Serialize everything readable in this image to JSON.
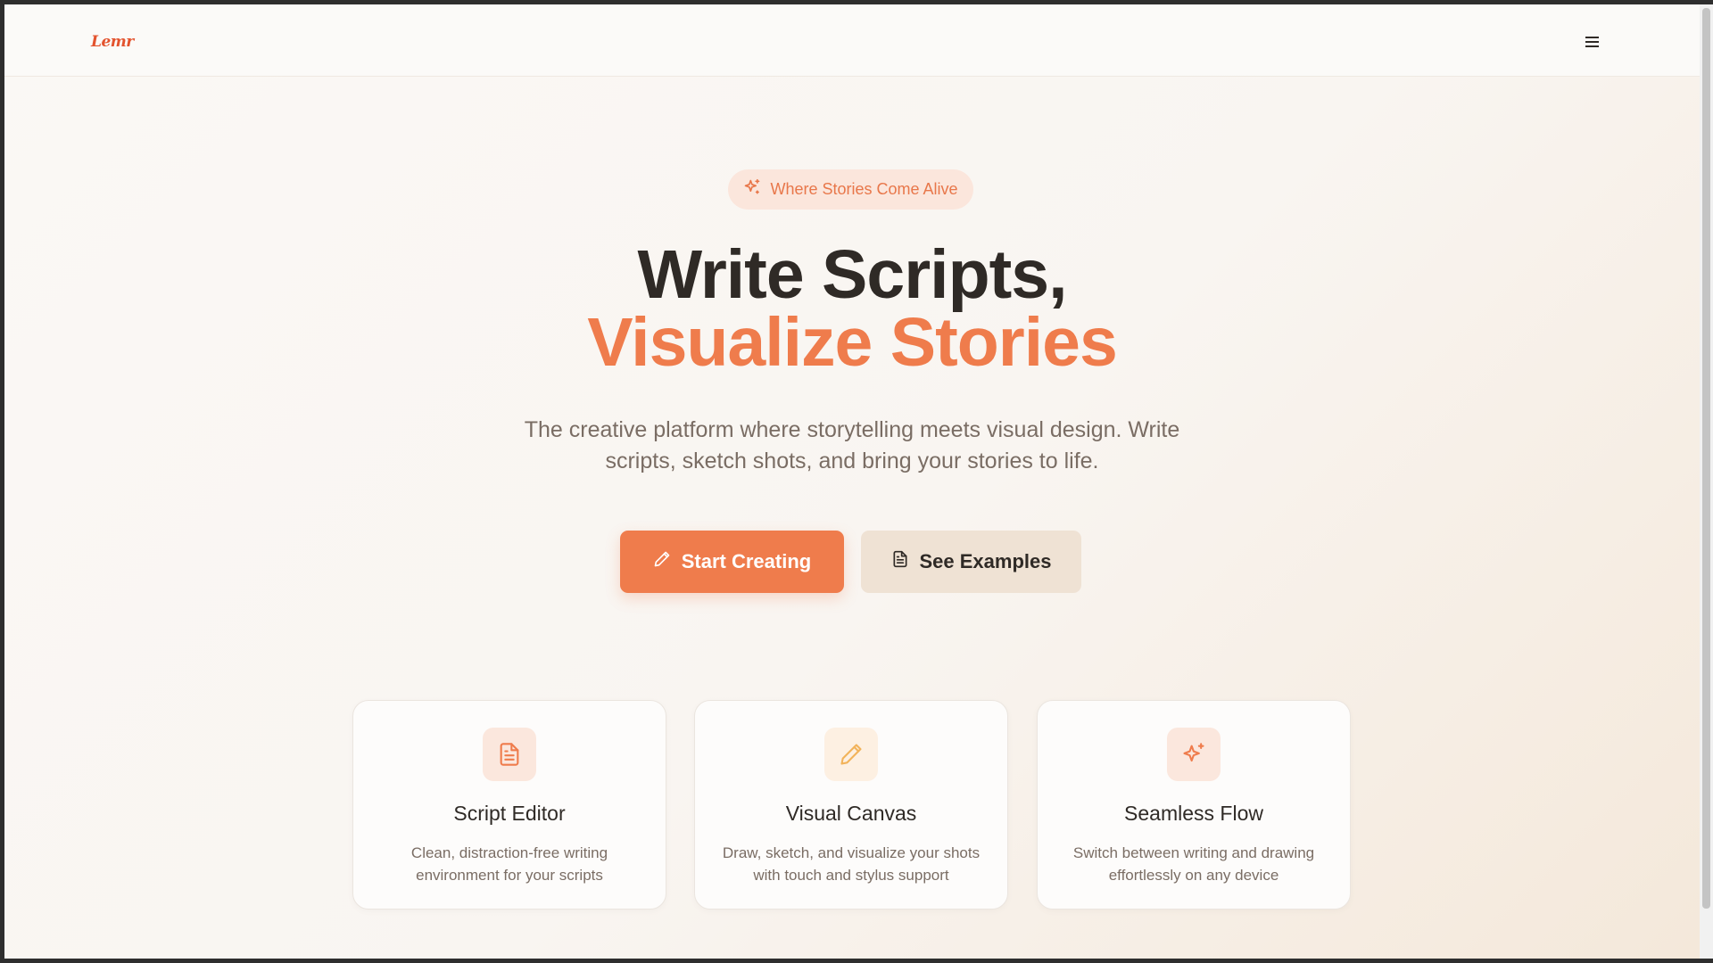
{
  "nav": {
    "logo": "Lemr",
    "menu_icon": "hamburger-icon"
  },
  "hero": {
    "badge": {
      "text": "Where Stories Come Alive",
      "icon": "sparkles-icon"
    },
    "title_line1": "Write Scripts,",
    "title_line2": "Visualize Stories",
    "subtitle": "The creative platform where storytelling meets visual design. Write scripts, sketch shots, and bring your stories to life.",
    "primary_button": {
      "label": "Start Creating",
      "icon": "pencil-icon"
    },
    "secondary_button": {
      "label": "See Examples",
      "icon": "file-text-icon"
    }
  },
  "features": [
    {
      "title": "Script Editor",
      "description": "Clean, distraction-free writing environment for your scripts",
      "icon": "file-text-icon"
    },
    {
      "title": "Visual Canvas",
      "description": "Draw, sketch, and visualize your shots with touch and stylus support",
      "icon": "pencil-icon"
    },
    {
      "title": "Seamless Flow",
      "description": "Switch between writing and drawing effortlessly on any device",
      "icon": "sparkles-icon"
    }
  ],
  "colors": {
    "accent": "#ef7c4c",
    "logo": "#e3532e",
    "heading": "#2f2a26",
    "muted_text": "#7a6d64",
    "secondary_button_bg": "#efe2d4",
    "badge_bg": "#fbe6dc"
  }
}
